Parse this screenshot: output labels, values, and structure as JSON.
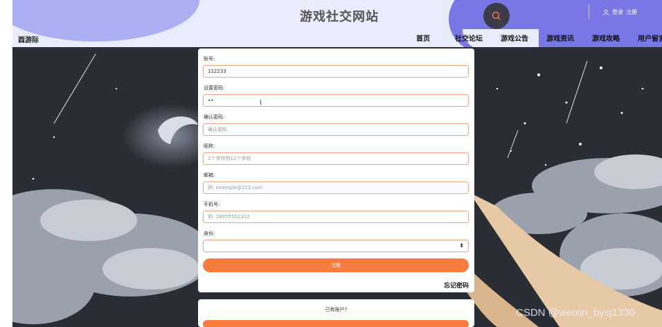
{
  "header": {
    "site_title": "游戏社交网站",
    "logo_text": "酉游际",
    "user_links": [
      "登录",
      "注册"
    ],
    "nav": [
      "首页",
      "社交论坛",
      "游戏公告",
      "游戏资讯",
      "游戏攻略",
      "用户留言"
    ]
  },
  "form": {
    "fields": [
      {
        "label": "账号:",
        "value": "112233",
        "placeholder": ""
      },
      {
        "label": "设置密码:",
        "value": "••",
        "placeholder": ""
      },
      {
        "label": "确认密码:",
        "value": "",
        "placeholder": "确认密码"
      },
      {
        "label": "昵称:",
        "value": "",
        "placeholder": "2个字符到12个字符"
      },
      {
        "label": "邮箱:",
        "value": "",
        "placeholder": "例: example@123.com"
      },
      {
        "label": "手机号:",
        "value": "",
        "placeholder": "例: 18955552312"
      }
    ],
    "identity_label": "身份:",
    "identity_value": "",
    "submit_label": "注册",
    "forgot_label": "忘记密码"
  },
  "footer_panel": {
    "have_account": "已有账户?"
  },
  "watermark": "CSDN @weixin_bysj1330",
  "colors": {
    "accent": "#f77c3e",
    "field_border": "#f2a186",
    "header_bg": "#e9ecfb",
    "header_blob": "#7877e6"
  }
}
